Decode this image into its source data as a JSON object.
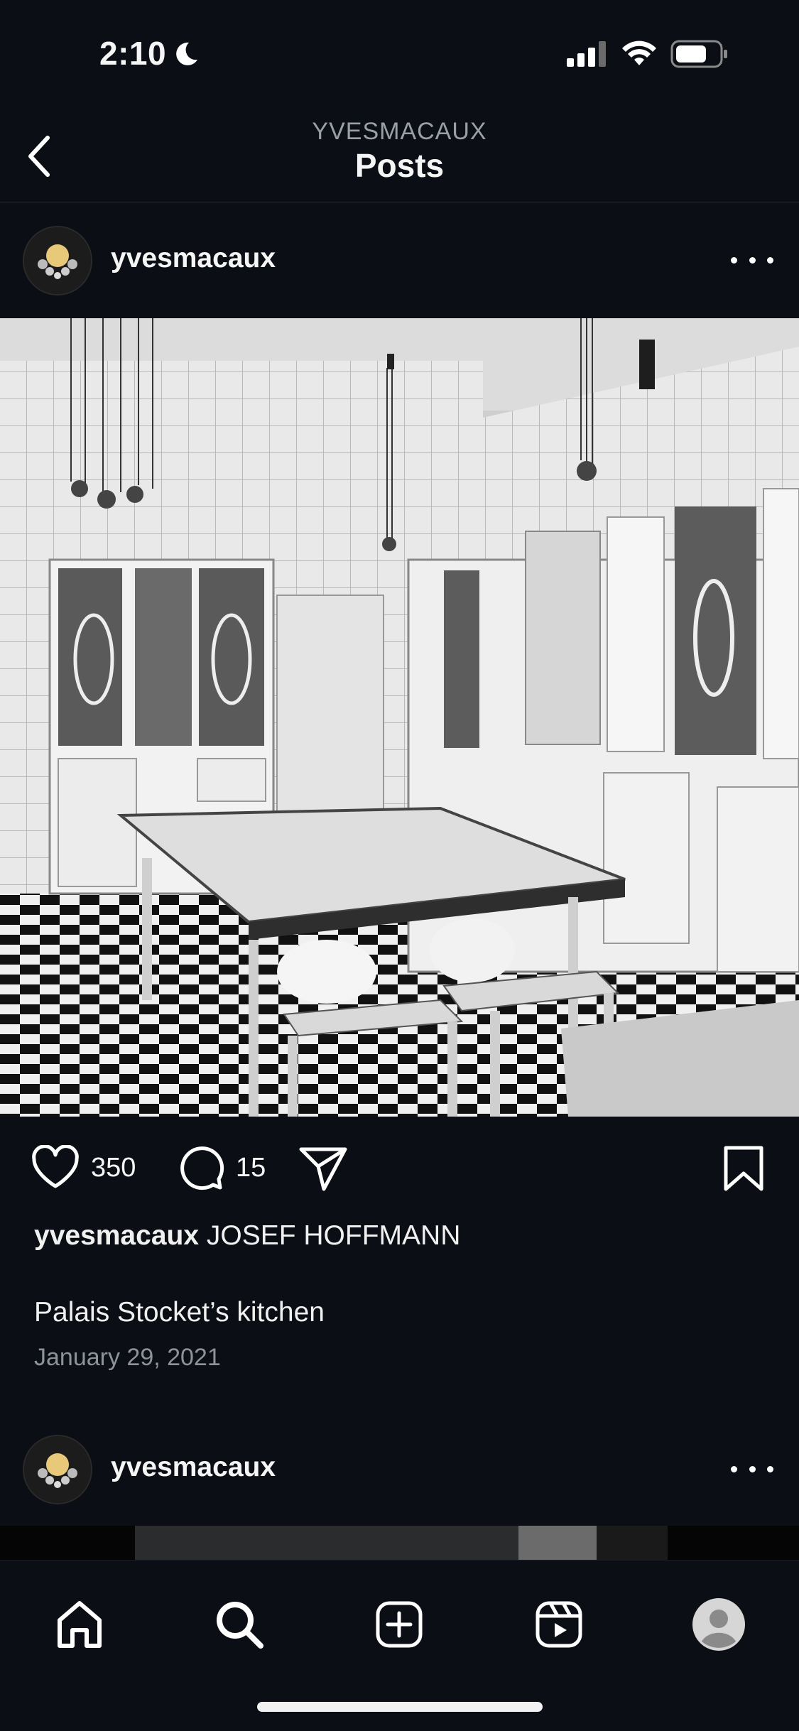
{
  "status_bar": {
    "time": "2:10"
  },
  "header": {
    "account": "YVESMACAUX",
    "title": "Posts"
  },
  "post": {
    "username": "yvesmacaux",
    "likes": "350",
    "comments": "15",
    "caption_user": "yvesmacaux",
    "caption_title": "JOSEF HOFFMANN",
    "caption_text": "Palais Stocket’s kitchen",
    "date": "January 29, 2021"
  },
  "next_post": {
    "username": "yvesmacaux"
  },
  "icons": {
    "back": "chevron-left-icon",
    "more": "more-horizontal-icon",
    "like": "heart-icon",
    "comment": "comment-icon",
    "share": "send-icon",
    "save": "bookmark-icon",
    "home": "home-icon",
    "search": "search-icon",
    "create": "plus-square-icon",
    "reels": "reels-icon",
    "profile": "profile-avatar-icon"
  },
  "colors": {
    "background": "#0b0e14",
    "text": "#f5f5f5",
    "muted": "#8e939a"
  }
}
